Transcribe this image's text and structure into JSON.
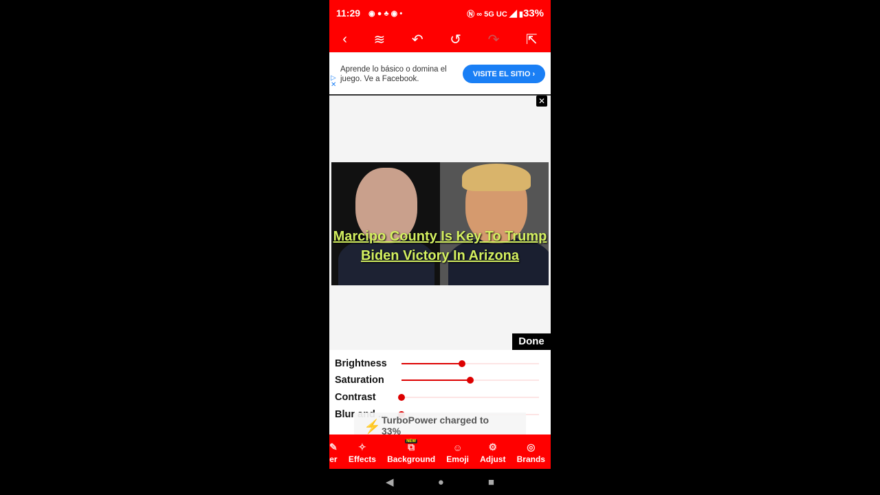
{
  "status": {
    "time": "11:29",
    "network": "5G UC",
    "battery": "33%"
  },
  "toolbar": {
    "icons": [
      "back-icon",
      "layers-icon",
      "undo-icon",
      "reset-icon",
      "redo-icon",
      "share-icon"
    ]
  },
  "ad": {
    "text": "Aprende lo básico o domina el juego. Ve a Facebook.",
    "button": "VISITE EL SITIO ›"
  },
  "canvas": {
    "caption": "Marcipo County Is Key To Trump Biden Victory In Arizona"
  },
  "done_label": "Done",
  "adjust": {
    "sliders": [
      {
        "label": "Brightness",
        "value": 44
      },
      {
        "label": "Saturation",
        "value": 50
      },
      {
        "label": "Contrast",
        "value": 0
      },
      {
        "label": "Blur and ...",
        "value": 0
      }
    ]
  },
  "toast": {
    "message": "TurboPower charged to 33%"
  },
  "bottom_nav": [
    {
      "label": "er"
    },
    {
      "label": "Effects"
    },
    {
      "label": "Background",
      "badge": "NEW"
    },
    {
      "label": "Emoji"
    },
    {
      "label": "Adjust"
    },
    {
      "label": "Brands"
    }
  ],
  "colors": {
    "accent": "#ff0000",
    "slider": "#dd0000",
    "ad_button": "#1a7ff5",
    "caption": "#d4f060"
  }
}
